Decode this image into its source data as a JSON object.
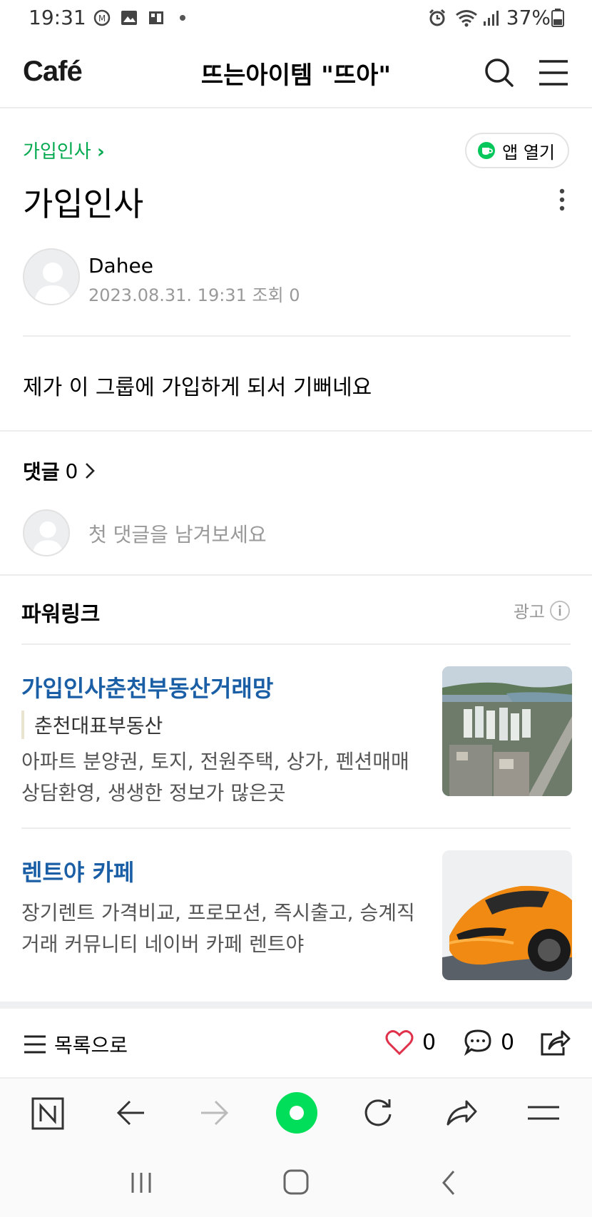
{
  "status_bar": {
    "time": "19:31",
    "battery": "37%",
    "left_icons": [
      "m-icon",
      "image-icon",
      "grid-icon"
    ],
    "right_icons": [
      "alarm-icon",
      "wifi-icon",
      "signal-icon",
      "battery-icon"
    ]
  },
  "header": {
    "logo": "Café",
    "cafe_name": "뜨는아이템 \"뜨아\""
  },
  "post": {
    "breadcrumb": "가입인사",
    "app_open_label": "앱 열기",
    "title": "가입인사",
    "author": "Dahee",
    "meta": "2023.08.31. 19:31  조회 0",
    "content": "제가 이 그룹에 가입하게 되서 기뻐네요"
  },
  "comments": {
    "label": "댓글",
    "count": "0",
    "placeholder": "첫 댓글을 남겨보세요"
  },
  "powerlink": {
    "title": "파워링크",
    "ad_label": "광고",
    "ads": [
      {
        "headline": "가입인사춘천부동산거래망",
        "sub": "춘천대표부동산",
        "desc_line1": "아파트 분양권, 토지, 전원주택, 상가, 펜션매매",
        "desc_line2": "상담환영, 생생한 정보가 많은곳"
      },
      {
        "headline": "렌트야 카페",
        "desc_line1": "장기렌트 가격비교, 프로모션, 즉시출고, 승계직",
        "desc_line2": "거래 커뮤니티 네이버 카페 렌트야"
      }
    ]
  },
  "actions": {
    "list_label": "목록으로",
    "like_count": "0",
    "comment_count": "0"
  },
  "colors": {
    "green": "#03a94f",
    "link_blue": "#1a5fa6",
    "heart_red": "#e0314b",
    "browser_green": "#00de5a"
  }
}
